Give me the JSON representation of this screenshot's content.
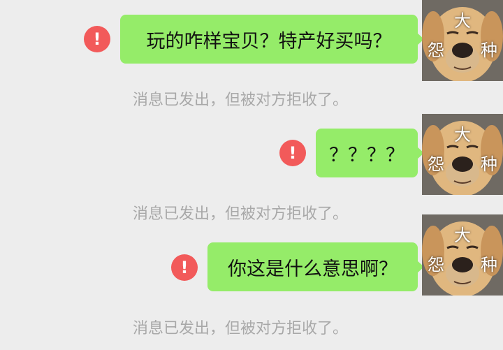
{
  "messages": [
    {
      "text": "玩的咋样宝贝？特产好买吗？",
      "status_icon": "!",
      "notice": "消息已发出，但被对方拒收了。"
    },
    {
      "text": "？？？？",
      "status_icon": "!",
      "notice": "消息已发出，但被对方拒收了。"
    },
    {
      "text": "你这是什么意思啊？",
      "status_icon": "!",
      "notice": "消息已发出，但被对方拒收了。"
    }
  ],
  "avatar": {
    "icon": "dog-avatar-icon",
    "caption_top": "大",
    "caption_left": "怨",
    "caption_right": "种"
  },
  "colors": {
    "background": "#ededed",
    "bubble": "#95ec69",
    "error": "#f25a5a",
    "notice_text": "#a8a8a8"
  }
}
